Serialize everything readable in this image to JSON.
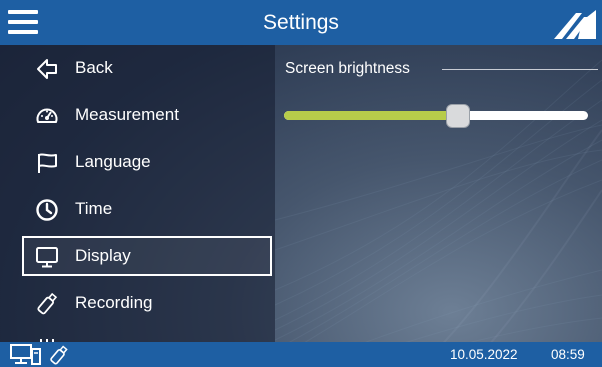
{
  "header": {
    "title": "Settings",
    "menu_icon": "hamburger-menu-icon",
    "logo_icon": "brand-logo-icon"
  },
  "sidebar": {
    "items": [
      {
        "label": "Back",
        "icon": "back-arrow-icon",
        "selected": false
      },
      {
        "label": "Measurement",
        "icon": "gauge-icon",
        "selected": false
      },
      {
        "label": "Language",
        "icon": "flag-icon",
        "selected": false
      },
      {
        "label": "Time",
        "icon": "clock-icon",
        "selected": false
      },
      {
        "label": "Display",
        "icon": "monitor-icon",
        "selected": true
      },
      {
        "label": "Recording",
        "icon": "usb-stick-icon",
        "selected": false
      }
    ]
  },
  "display_settings": {
    "brightness_label": "Screen brightness",
    "brightness_level": 0.58
  },
  "statusbar": {
    "date": "10.05.2022",
    "time": "08:59",
    "icons": [
      "computer-connection-icon",
      "usb-stick-icon"
    ]
  },
  "colors": {
    "bar_blue": "#1e5fa3",
    "slider_fill": "#b7cc4a",
    "selection_border": "#ffffff"
  }
}
